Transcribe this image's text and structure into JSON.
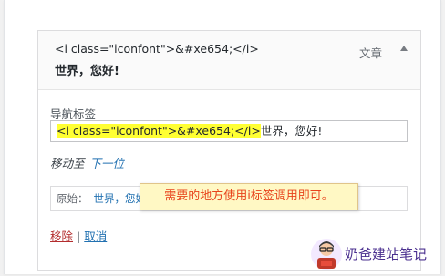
{
  "menu_item": {
    "title_code": "<i class=\"iconfont\">&#xe654;</i>",
    "title_text": "世界，您好!",
    "item_type": "文章",
    "nav_label": "导航标签",
    "input_highlight": "<i class=\"iconfont\">&#xe654;</i>",
    "input_rest": "世界，您好!",
    "move_label": "移动至",
    "move_link": "下一位",
    "original_label": "原始：",
    "original_link": "世界，您好!",
    "remove_label": "移除",
    "separator": "|",
    "cancel_label": "取消"
  },
  "callout": {
    "text": "需要的地方使用i标签调用即可。"
  },
  "watermark": {
    "text": "奶爸建站笔记"
  },
  "colors": {
    "highlight": "#ffff33",
    "callout_text": "#e8431b",
    "link": "#2271b1",
    "remove": "#b32d2e"
  }
}
